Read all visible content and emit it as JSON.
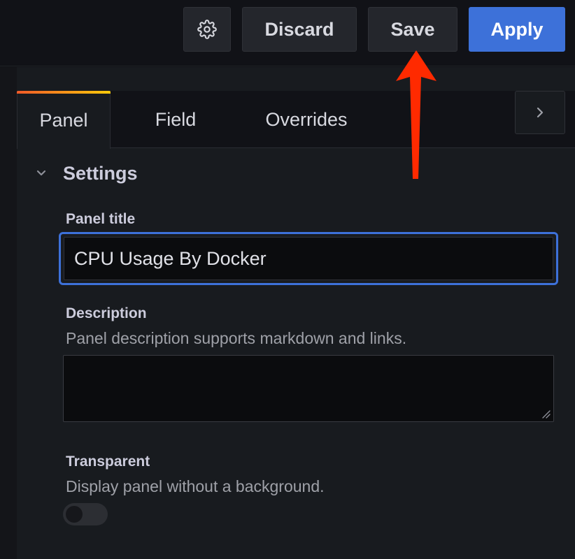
{
  "toolbar": {
    "settings_icon": "gear-icon",
    "discard_label": "Discard",
    "save_label": "Save",
    "apply_label": "Apply"
  },
  "tabs": {
    "items": [
      {
        "label": "Panel",
        "active": true
      },
      {
        "label": "Field",
        "active": false
      },
      {
        "label": "Overrides",
        "active": false
      }
    ],
    "scroll_icon": "chevron-right-icon"
  },
  "settings": {
    "section_title": "Settings",
    "panel_title": {
      "label": "Panel title",
      "value": "CPU Usage By Docker"
    },
    "description": {
      "label": "Description",
      "help": "Panel description supports markdown and links.",
      "value": ""
    },
    "transparent": {
      "label": "Transparent",
      "help": "Display panel without a background.",
      "enabled": false
    }
  },
  "annotation": {
    "type": "arrow",
    "color": "#ff2a00",
    "points_to": "save-button"
  },
  "colors": {
    "background": "#111217",
    "pane": "#181b1f",
    "primary": "#3d71d9",
    "tab_accent_start": "#f05a28",
    "tab_accent_end": "#fbca0a"
  }
}
